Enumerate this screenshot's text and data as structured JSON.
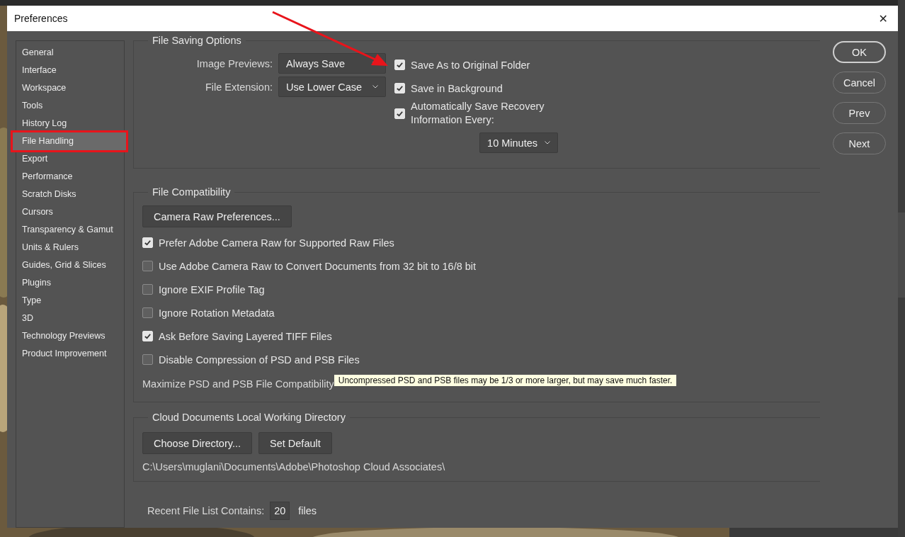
{
  "window": {
    "title": "Preferences",
    "close": "✕"
  },
  "sidebar": {
    "items": [
      {
        "label": "General",
        "selected": false,
        "annotated": false
      },
      {
        "label": "Interface",
        "selected": false,
        "annotated": false
      },
      {
        "label": "Workspace",
        "selected": false,
        "annotated": false
      },
      {
        "label": "Tools",
        "selected": false,
        "annotated": false
      },
      {
        "label": "History Log",
        "selected": false,
        "annotated": false
      },
      {
        "label": "File Handling",
        "selected": true,
        "annotated": true
      },
      {
        "label": "Export",
        "selected": false,
        "annotated": false
      },
      {
        "label": "Performance",
        "selected": false,
        "annotated": false
      },
      {
        "label": "Scratch Disks",
        "selected": false,
        "annotated": false
      },
      {
        "label": "Cursors",
        "selected": false,
        "annotated": false
      },
      {
        "label": "Transparency & Gamut",
        "selected": false,
        "annotated": false
      },
      {
        "label": "Units & Rulers",
        "selected": false,
        "annotated": false
      },
      {
        "label": "Guides, Grid & Slices",
        "selected": false,
        "annotated": false
      },
      {
        "label": "Plugins",
        "selected": false,
        "annotated": false
      },
      {
        "label": "Type",
        "selected": false,
        "annotated": false
      },
      {
        "label": "3D",
        "selected": false,
        "annotated": false
      },
      {
        "label": "Technology Previews",
        "selected": false,
        "annotated": false
      },
      {
        "label": "Product Improvement",
        "selected": false,
        "annotated": false
      }
    ]
  },
  "file_saving_options": {
    "title": "File Saving Options",
    "dropdowns": [
      {
        "label": "Image Previews:",
        "value": "Always Save"
      },
      {
        "label": "File Extension:",
        "value": "Use Lower Case"
      }
    ],
    "checkboxes": [
      {
        "label": "Save As to Original Folder",
        "checked": true
      },
      {
        "label": "Save in Background",
        "checked": true
      },
      {
        "label": "Automatically Save Recovery Information Every:",
        "checked": true
      }
    ],
    "interval": {
      "value": "10 Minutes"
    }
  },
  "file_compatibility": {
    "title": "File Compatibility",
    "button": "Camera Raw Preferences...",
    "checkboxes": [
      {
        "label": "Prefer Adobe Camera Raw for Supported Raw Files",
        "checked": true
      },
      {
        "label": "Use Adobe Camera Raw to Convert Documents from 32 bit to 16/8 bit",
        "checked": false
      },
      {
        "label": "Ignore EXIF Profile Tag",
        "checked": false
      },
      {
        "label": "Ignore Rotation Metadata",
        "checked": false
      },
      {
        "label": "Ask Before Saving Layered TIFF Files",
        "checked": true
      },
      {
        "label": "Disable Compression of PSD and PSB Files",
        "checked": false
      }
    ],
    "maximize_label": "Maximize PSD and PSB File Compatibility",
    "tooltip": "Uncompressed PSD and PSB files may be 1/3 or more larger, but may save much faster."
  },
  "cloud_documents": {
    "title": "Cloud Documents Local Working Directory",
    "buttons": [
      "Choose Directory...",
      "Set Default"
    ],
    "path": "C:\\Users\\muglani\\Documents\\Adobe\\Photoshop Cloud Associates\\"
  },
  "recent_files": {
    "label": "Recent File List Contains:",
    "value": "20",
    "unit": "files"
  },
  "buttons": [
    {
      "label": "OK",
      "kind": "default"
    },
    {
      "label": "Cancel",
      "kind": "normal"
    },
    {
      "label": "Prev",
      "kind": "normal"
    },
    {
      "label": "Next",
      "kind": "normal"
    }
  ]
}
